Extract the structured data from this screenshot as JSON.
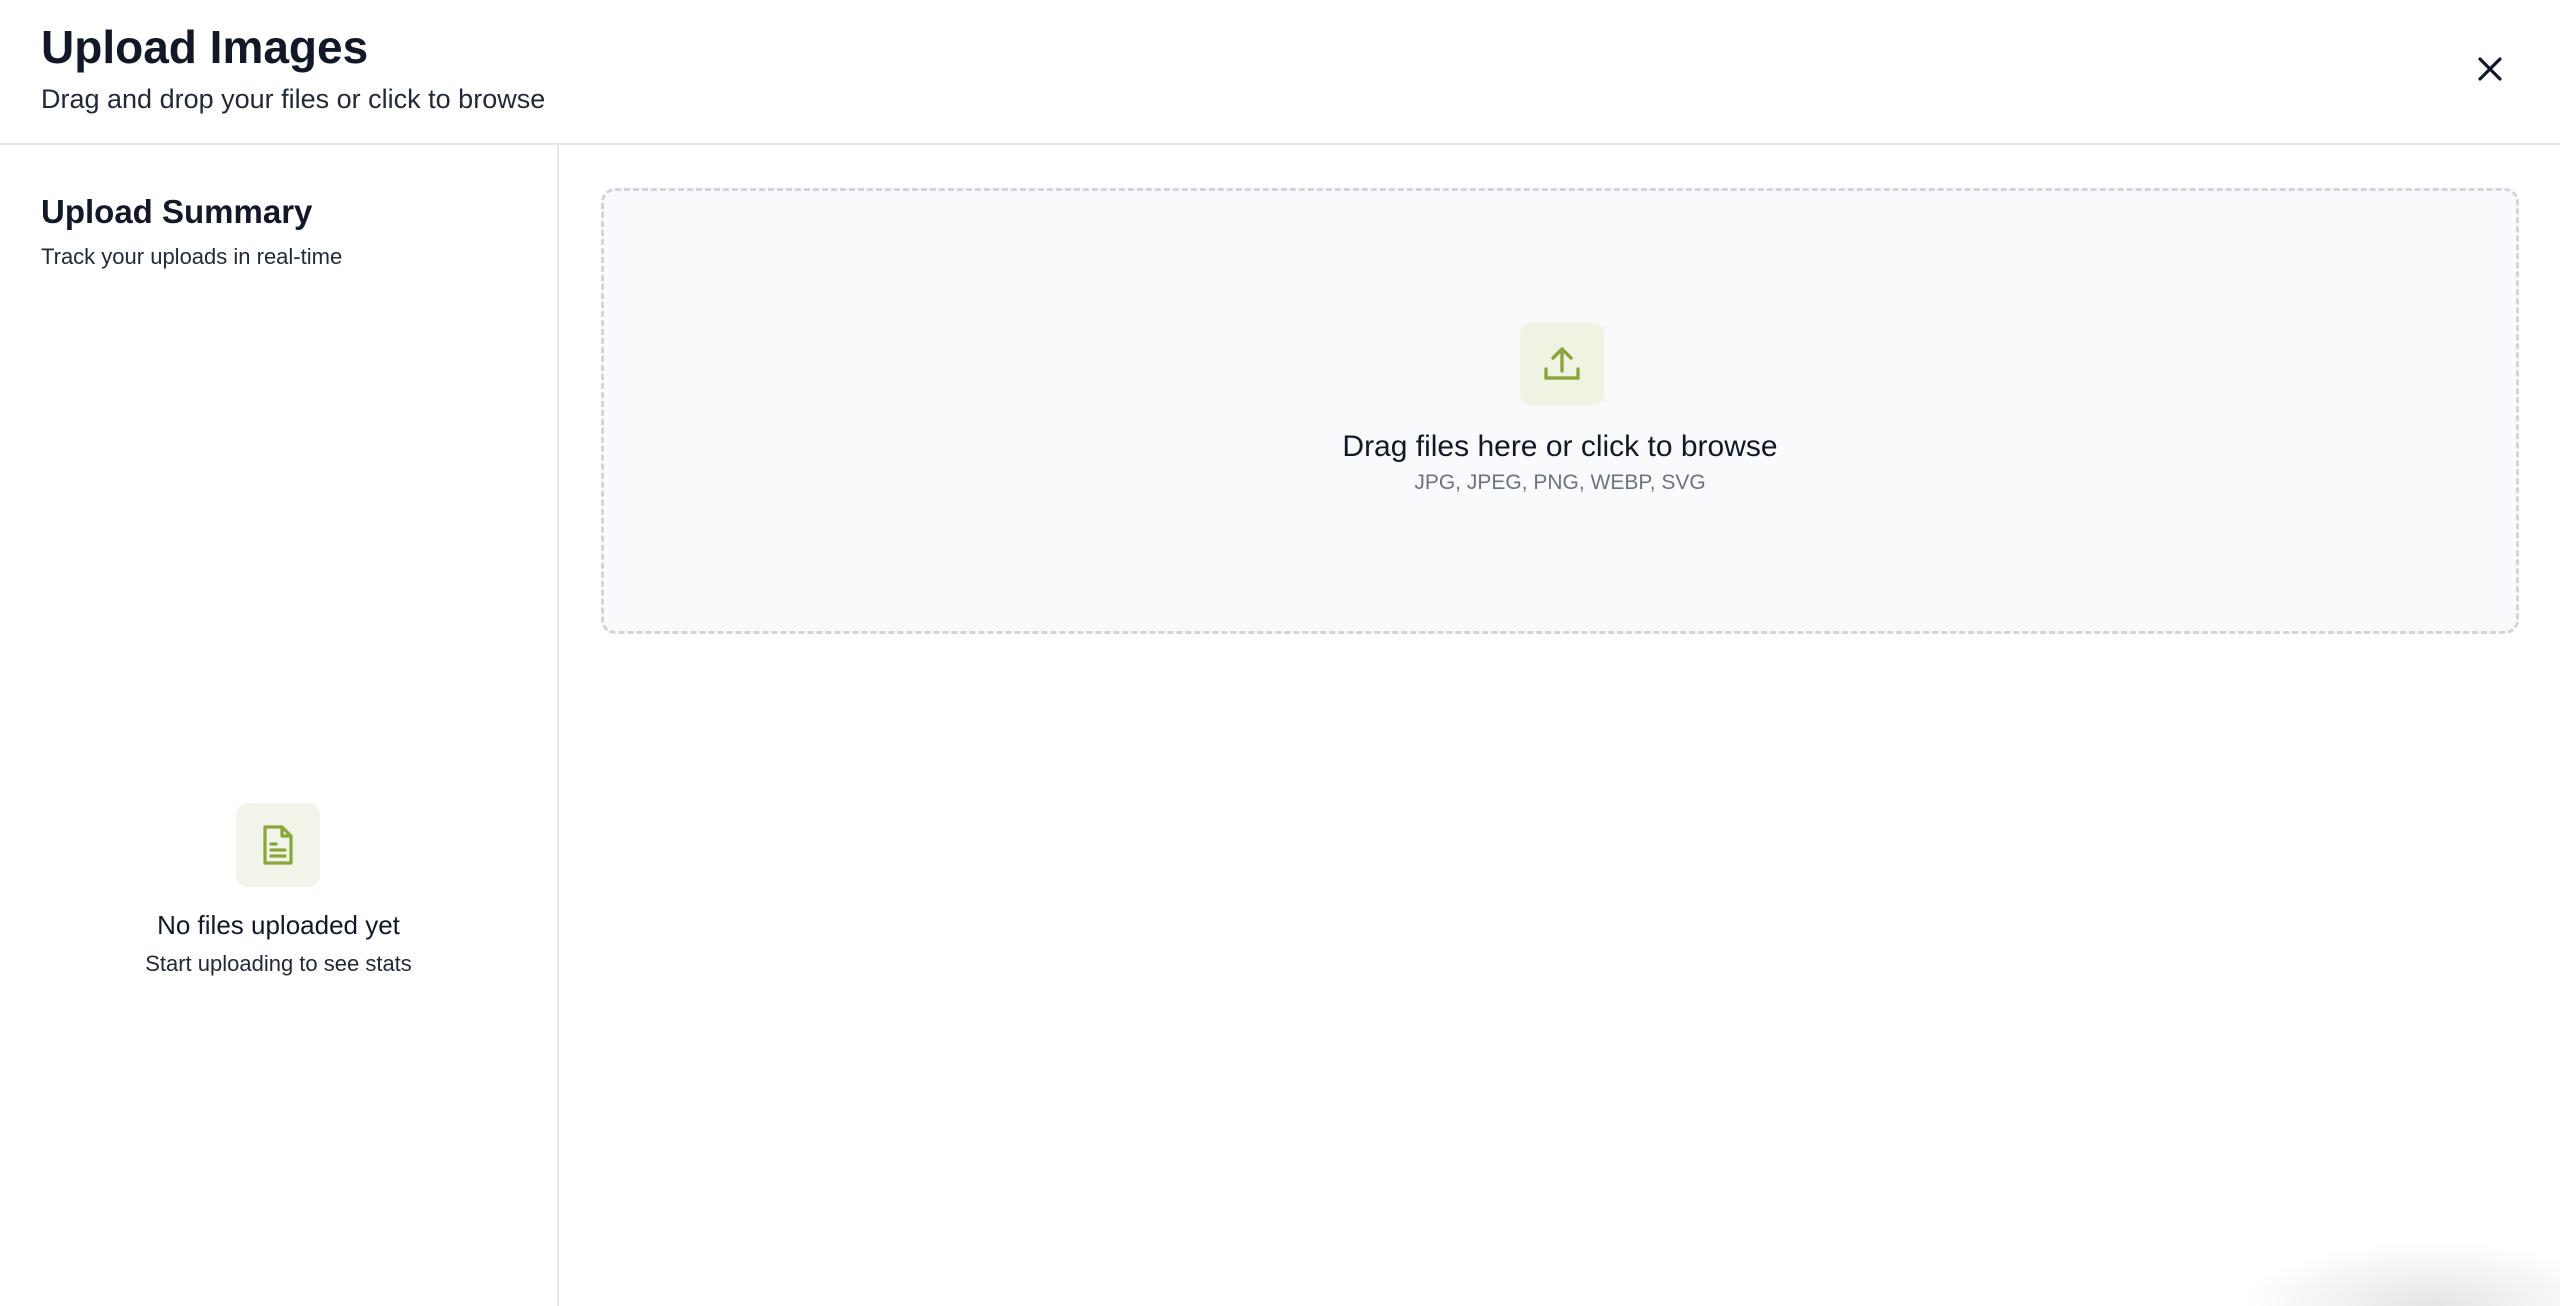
{
  "header": {
    "title": "Upload Images",
    "subtitle": "Drag and drop your files or click to browse",
    "close_icon": "close-icon"
  },
  "sidebar": {
    "title": "Upload Summary",
    "subtitle": "Track your uploads in real-time",
    "empty_state": {
      "icon": "document-icon",
      "title": "No files uploaded yet",
      "subtitle": "Start uploading to see stats"
    }
  },
  "dropzone": {
    "icon": "upload-icon",
    "title": "Drag files here or click to browse",
    "formats": "JPG, JPEG, PNG, WEBP, SVG"
  },
  "colors": {
    "accent": "#8aa63a",
    "icon_bg": "#eef3e2",
    "border": "#e5e7eb",
    "dropzone_border": "#d1d5db",
    "dropzone_bg": "#f9fafb"
  }
}
